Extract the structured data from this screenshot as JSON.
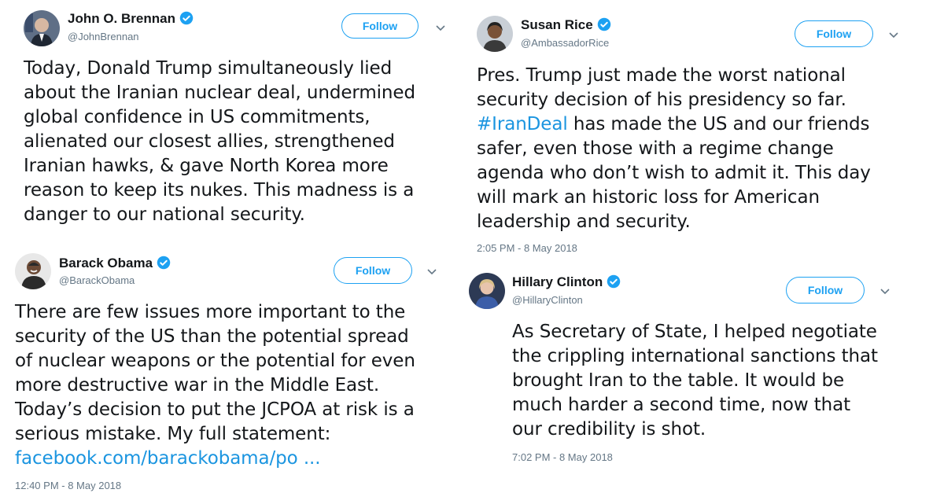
{
  "brennan": {
    "name": "John O. Brennan",
    "handle": "@JohnBrennan",
    "follow": "Follow",
    "lines": [
      "Today, Donald Trump simultaneously lied",
      "about the Iranian nuclear deal, undermined",
      "global confidence in US commitments,",
      "alienated our closest allies, strengthened",
      "Iranian hawks, & gave North Korea more",
      "reason to keep its nukes. This madness is a",
      "danger to our national security."
    ]
  },
  "obama": {
    "name": "Barack Obama",
    "handle": "@BarackObama",
    "follow": "Follow",
    "lines": [
      "There are few issues more important to the",
      "security of the US than the potential spread",
      "of nuclear weapons or the potential for even",
      "more destructive war in the Middle East.",
      "Today’s decision to put the JCPOA at risk is a",
      "serious mistake. My full statement:"
    ],
    "link": "facebook.com/barackobama/po ...",
    "timestamp": "12:40 PM - 8 May 2018"
  },
  "rice": {
    "name": "Susan Rice",
    "handle": "@AmbassadorRice",
    "follow": "Follow",
    "line1": "Pres. Trump just made the worst national",
    "line2": "security decision of his presidency so far.",
    "hashtag": "#IranDeal",
    "line3_rest": " has made the US and our friends",
    "line4": "safer, even those with a regime change",
    "line5": "agenda who don’t wish to admit it. This day",
    "line6": "will mark an historic loss for American",
    "line7": "leadership and security.",
    "timestamp": "2:05 PM - 8 May 2018"
  },
  "clinton": {
    "name": "Hillary Clinton",
    "handle": "@HillaryClinton",
    "follow": "Follow",
    "lines": [
      "As Secretary of State, I helped negotiate",
      "the crippling international sanctions that",
      "brought Iran to the table. It would be",
      "much harder a second time, now that",
      "our credibility is shot."
    ],
    "timestamp": "7:02 PM - 8 May 2018"
  },
  "colors": {
    "accent": "#1da1f2",
    "link": "#1b95e0",
    "muted": "#657786",
    "text": "#14171a"
  },
  "icons": {
    "verified": "verified-badge-icon",
    "chevron": "chevron-down-icon"
  }
}
